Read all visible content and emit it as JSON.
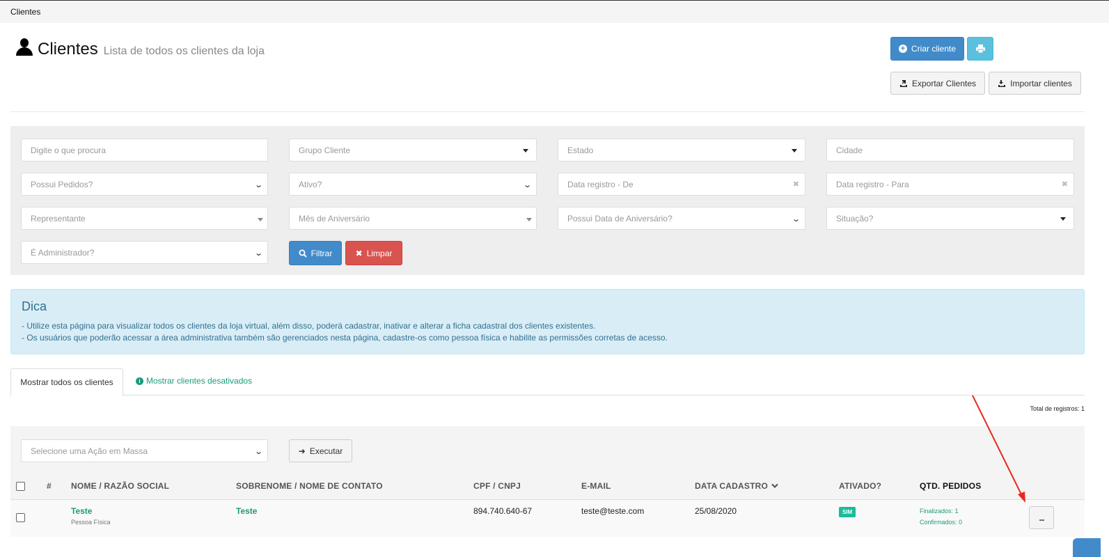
{
  "breadcrumb": "Clientes",
  "header": {
    "title": "Clientes",
    "subtitle": "Lista de todos os clientes da loja"
  },
  "actions": {
    "create": "Criar cliente",
    "export": "Exportar Clientes",
    "import": "Importar clientes"
  },
  "filters": {
    "search": "Digite o que procura",
    "group": "Grupo Cliente",
    "state": "Estado",
    "city": "Cidade",
    "has_orders": "Possui Pedidos?",
    "active": "Ativo?",
    "date_from": "Data registro - De",
    "date_to": "Data registro - Para",
    "representative": "Representante",
    "birthday_month": "Mês de Aniversário",
    "has_birthday": "Possui Data de Aniversário?",
    "situation": "Situação?",
    "is_admin": "É Administrador?",
    "filter_btn": "Filtrar",
    "clear_btn": "Limpar"
  },
  "tip": {
    "title": "Dica",
    "line1": "- Utilize esta página para visualizar todos os clientes da loja virtual, além disso, poderá cadastrar, inativar e alterar a ficha cadastral dos clientes existentes.",
    "line2": "- Os usuários que poderão acessar a área administrativa também são gerenciados nesta página, cadastre-os como pessoa física e habilite as permissões corretas de acesso."
  },
  "tabs": {
    "all": "Mostrar todos os clientes",
    "disabled": "Mostrar clientes desativados"
  },
  "total": "Total de registros: 1",
  "bulk": {
    "placeholder": "Selecione uma Ação em Massa",
    "execute": "Executar"
  },
  "table": {
    "headers": {
      "num": "#",
      "name": "NOME / RAZÃO SOCIAL",
      "surname": "SOBRENOME / NOME DE CONTATO",
      "cpf": "CPF / CNPJ",
      "email": "E-MAIL",
      "date": "DATA CADASTRO",
      "active": "ATIVADO?",
      "orders": "QTD. PEDIDOS"
    },
    "rows": [
      {
        "name": "Teste",
        "person_type": "Pessoa Física",
        "surname": "Teste",
        "cpf": "894.740.640-67",
        "email": "teste@teste.com",
        "date": "25/08/2020",
        "active": "SIM",
        "finalized": "Finalizados: 1",
        "confirmed": "Confirmados: 0",
        "more": "..."
      }
    ]
  },
  "colors": {
    "primary": "#428bca",
    "info": "#5bc0de",
    "danger": "#d9534f",
    "success": "#1abc9c",
    "link": "#1a9b7a",
    "annotation_arrow": "#e8281e"
  }
}
